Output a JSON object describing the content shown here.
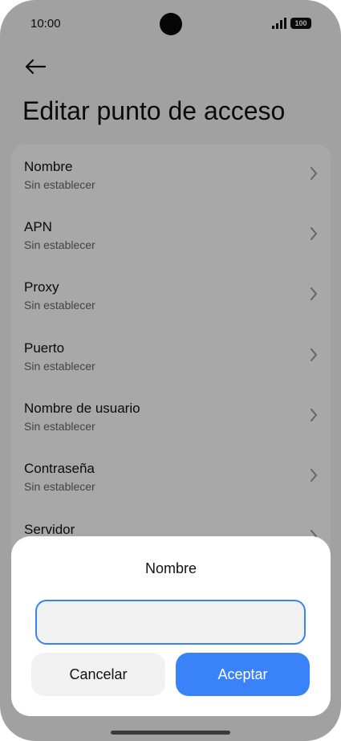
{
  "status_bar": {
    "time": "10:00",
    "battery": "100",
    "icons": [
      "signal-icon",
      "battery-icon"
    ]
  },
  "header": {
    "back_icon": "arrow-left-icon",
    "title": "Editar punto de acceso"
  },
  "settings": {
    "items": [
      {
        "title": "Nombre",
        "value": "Sin establecer"
      },
      {
        "title": "APN",
        "value": "Sin establecer"
      },
      {
        "title": "Proxy",
        "value": "Sin establecer"
      },
      {
        "title": "Puerto",
        "value": "Sin establecer"
      },
      {
        "title": "Nombre de usuario",
        "value": "Sin establecer"
      },
      {
        "title": "Contraseña",
        "value": "Sin establecer"
      },
      {
        "title": "Servidor",
        "value": ""
      }
    ]
  },
  "dialog": {
    "title": "Nombre",
    "input_value": "",
    "cancel_label": "Cancelar",
    "accept_label": "Aceptar"
  },
  "colors": {
    "accent": "#3a82f7",
    "overlay": "rgba(0,0,0,0.34)"
  }
}
